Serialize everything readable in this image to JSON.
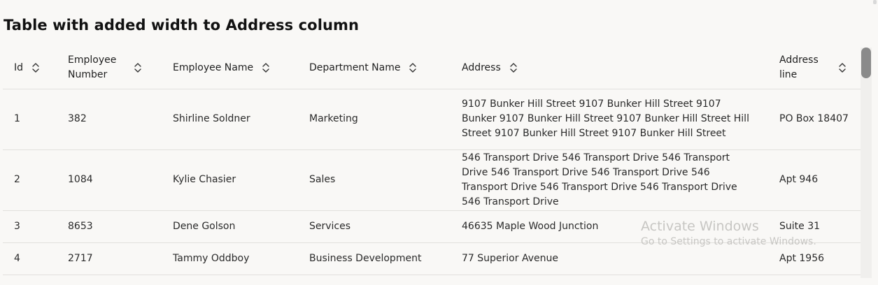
{
  "page": {
    "title": "Table with added width to Address column"
  },
  "table": {
    "columns": [
      {
        "key": "id",
        "label": "Id"
      },
      {
        "key": "employee_number",
        "label": "Employee Number"
      },
      {
        "key": "employee_name",
        "label": "Employee Name"
      },
      {
        "key": "department_name",
        "label": "Department Name"
      },
      {
        "key": "address",
        "label": "Address"
      },
      {
        "key": "address_line",
        "label": "Address line"
      }
    ],
    "rows": [
      {
        "id": "1",
        "employee_number": "382",
        "employee_name": "Shirline Soldner",
        "department_name": "Marketing",
        "address": "9107 Bunker Hill Street 9107 Bunker Hill Street 9107 Bunker 9107 Bunker Hill Street 9107 Bunker Hill Street Hill Street 9107 Bunker Hill Street 9107 Bunker Hill Street",
        "address_line": "PO Box 18407"
      },
      {
        "id": "2",
        "employee_number": "1084",
        "employee_name": "Kylie Chasier",
        "department_name": "Sales",
        "address": "546 Transport Drive 546 Transport Drive 546 Transport Drive 546 Transport Drive 546 Transport Drive 546 Transport Drive 546 Transport Drive 546 Transport Drive 546 Transport Drive",
        "address_line": "Apt 946"
      },
      {
        "id": "3",
        "employee_number": "8653",
        "employee_name": "Dene Golson",
        "department_name": "Services",
        "address": "46635 Maple Wood Junction",
        "address_line": "Suite 31"
      },
      {
        "id": "4",
        "employee_number": "2717",
        "employee_name": "Tammy Oddboy",
        "department_name": "Business Development",
        "address": "77 Superior Avenue",
        "address_line": "Apt 1956"
      }
    ],
    "sort_icon": "chevron-up-down-icon"
  },
  "watermark": {
    "line1": "Activate Windows",
    "line2": "Go to Settings to activate Windows."
  },
  "colors": {
    "background": "#f9f8f6",
    "row_border": "#e2e0dd",
    "scroll_thumb": "#8a8a8a"
  }
}
